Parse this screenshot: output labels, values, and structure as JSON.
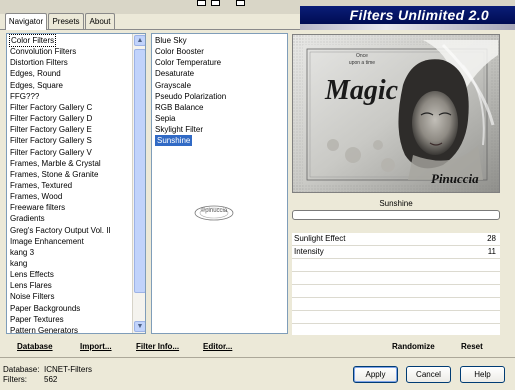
{
  "tabs": [
    "Navigator",
    "Presets",
    "About"
  ],
  "banner_title": "Filters Unlimited 2.0",
  "categories": [
    "Color Filters",
    "Convolution Filters",
    "Distortion Filters",
    "Edges, Round",
    "Edges, Square",
    "FFG???",
    "Filter Factory Gallery C",
    "Filter Factory Gallery D",
    "Filter Factory Gallery E",
    "Filter Factory Gallery S",
    "Filter Factory Gallery V",
    "Frames, Marble & Crystal",
    "Frames, Stone & Granite",
    "Frames, Textured",
    "Frames, Wood",
    "Freeware filters",
    "Gradients",
    "Greg's Factory Output Vol. II",
    "Image Enhancement",
    "kang 3",
    "kang",
    "Lens Effects",
    "Lens Flares",
    "Noise Filters",
    "Paper Backgrounds",
    "Paper Textures",
    "Pattern Generators"
  ],
  "filters": [
    "Blue Sky",
    "Color Booster",
    "Color Temperature",
    "Desaturate",
    "Grayscale",
    "Pseudo Polarization",
    "RGB Balance",
    "Sepia",
    "Skylight Filter",
    "Sunshine"
  ],
  "watermark": "©pinuccia",
  "preview": {
    "magic": "Magic",
    "small_top": "Once",
    "small_mid": "upon a time",
    "signature": "Pinuccia"
  },
  "selected_filter_name": "Sunshine",
  "progress": 0,
  "params": [
    {
      "name": "Sunlight Effect",
      "value": "28"
    },
    {
      "name": "Intensity",
      "value": "11"
    }
  ],
  "links": {
    "database": "Database",
    "import": "Import...",
    "filter_info": "Filter Info...",
    "editor": "Editor...",
    "randomize": "Randomize",
    "reset": "Reset"
  },
  "status": {
    "database_label": "Database:",
    "database_value": "ICNET-Filters",
    "filters_label": "Filters:",
    "filters_value": "562"
  },
  "buttons": {
    "apply": "Apply",
    "cancel": "Cancel",
    "help": "Help"
  },
  "colors": {
    "selection": "#316ac5",
    "banner": "#0a1e78"
  }
}
